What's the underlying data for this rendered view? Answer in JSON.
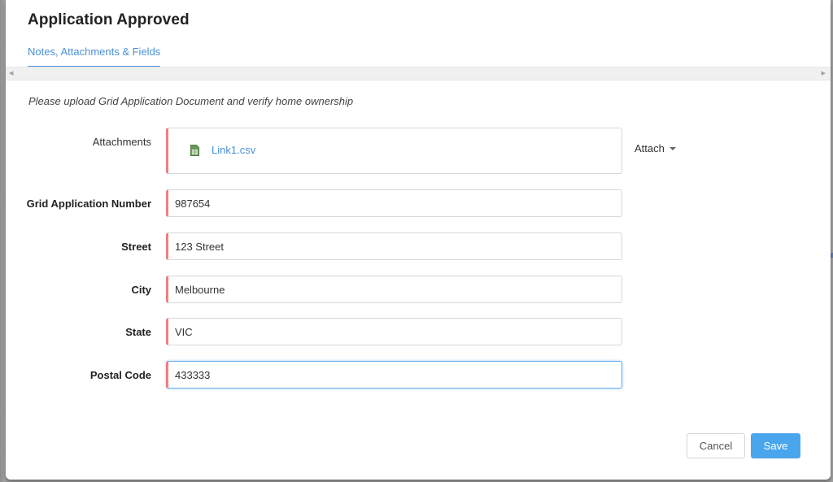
{
  "dialog": {
    "title": "Application Approved",
    "tabs": [
      {
        "label": "Notes, Attachments & Fields",
        "active": true
      }
    ],
    "instructions": "Please upload Grid Application Document and verify home ownership"
  },
  "attachments": {
    "label": "Attachments",
    "files": [
      {
        "name": "Link1.csv",
        "icon": "spreadsheet-file-icon"
      }
    ],
    "attach_button": "Attach"
  },
  "fields": [
    {
      "label": "Grid Application Number",
      "value": "987654",
      "required": true
    },
    {
      "label": "Street",
      "value": "123 Street",
      "required": true
    },
    {
      "label": "City",
      "value": "Melbourne",
      "required": true
    },
    {
      "label": "State",
      "value": "VIC",
      "required": true
    },
    {
      "label": "Postal Code",
      "value": "433333",
      "required": true,
      "focused": true
    }
  ],
  "footer": {
    "cancel_label": "Cancel",
    "save_label": "Save"
  },
  "colors": {
    "accent": "#4a90d9",
    "required_marker": "#ef7f7f",
    "save_button": "#4aa6ec"
  }
}
